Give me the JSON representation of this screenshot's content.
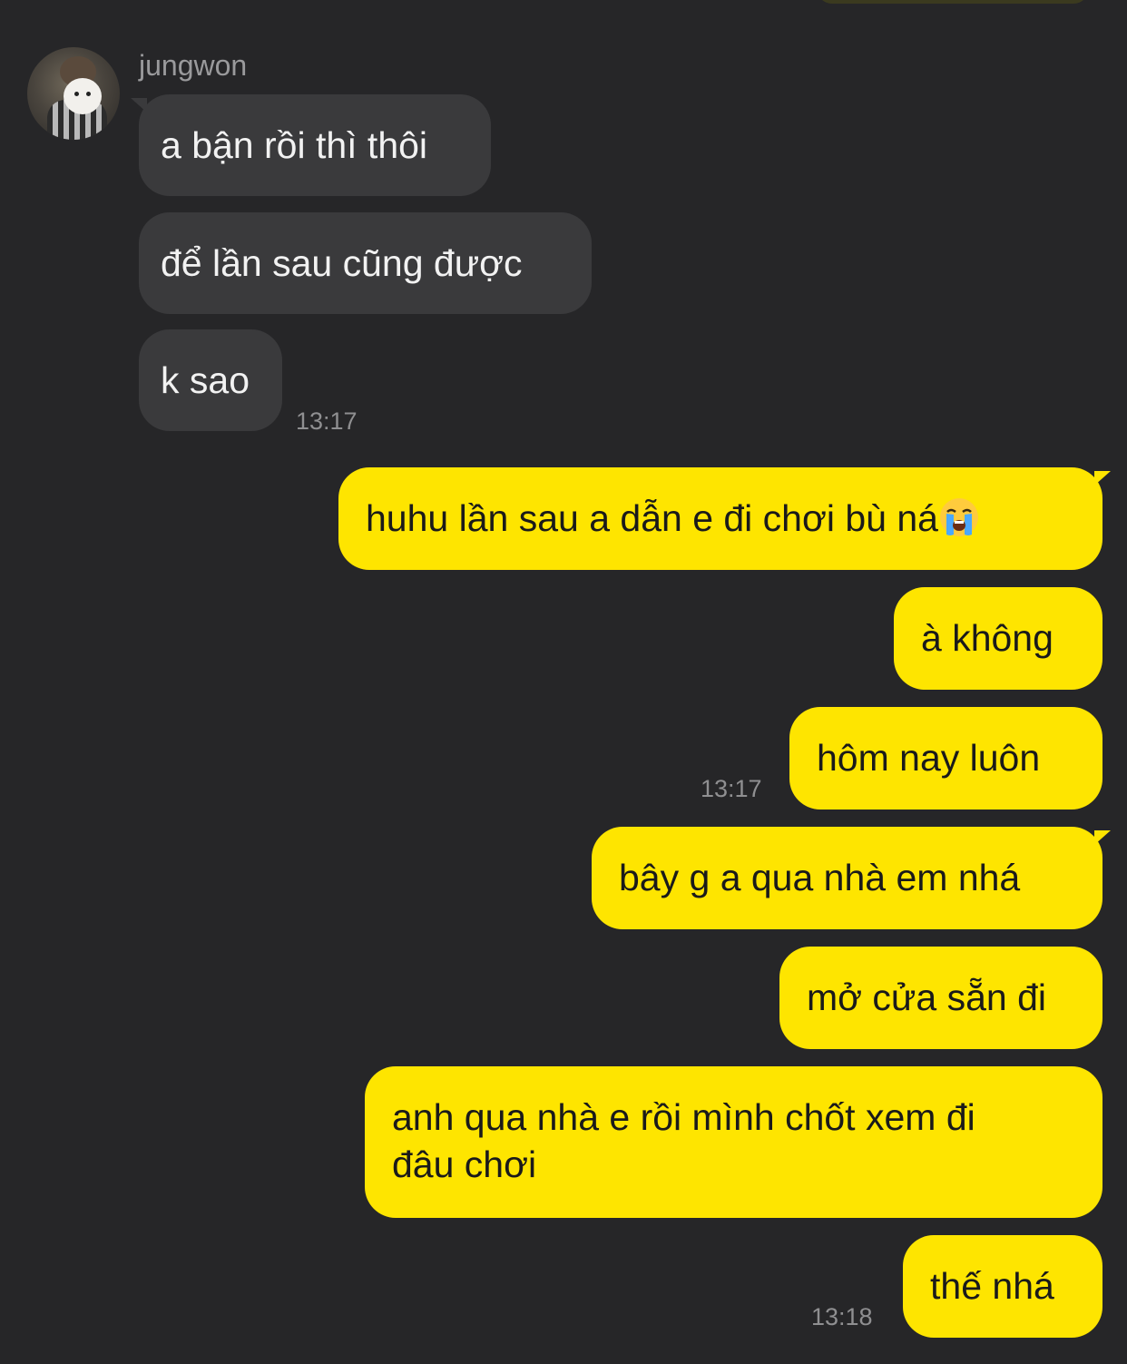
{
  "chat": {
    "sender_name": "jungwon",
    "incoming": [
      {
        "text": "a bận rồi thì thôi"
      },
      {
        "text": "để lần sau cũng được"
      },
      {
        "text": "k sao"
      }
    ],
    "incoming_time": "13:17",
    "outgoing_group_1": [
      {
        "text": "huhu lần sau a dẫn e đi chơi bù ná",
        "emoji": "loudly-crying-face"
      },
      {
        "text": "à không"
      },
      {
        "text": "hôm nay luôn"
      }
    ],
    "outgoing_time_1": "13:17",
    "outgoing_group_2": [
      {
        "text": "bây g a qua nhà em nhá"
      },
      {
        "text": "mở cửa sẵn đi"
      },
      {
        "text": "anh qua nhà e rồi mình chốt xem đi",
        "text2": "đâu chơi"
      },
      {
        "text": "thế nhá"
      }
    ],
    "outgoing_time_2": "13:18"
  },
  "colors": {
    "background": "#262628",
    "incoming_bubble": "#3a3a3c",
    "outgoing_bubble": "#fee500",
    "timestamp": "#8f8f91"
  }
}
